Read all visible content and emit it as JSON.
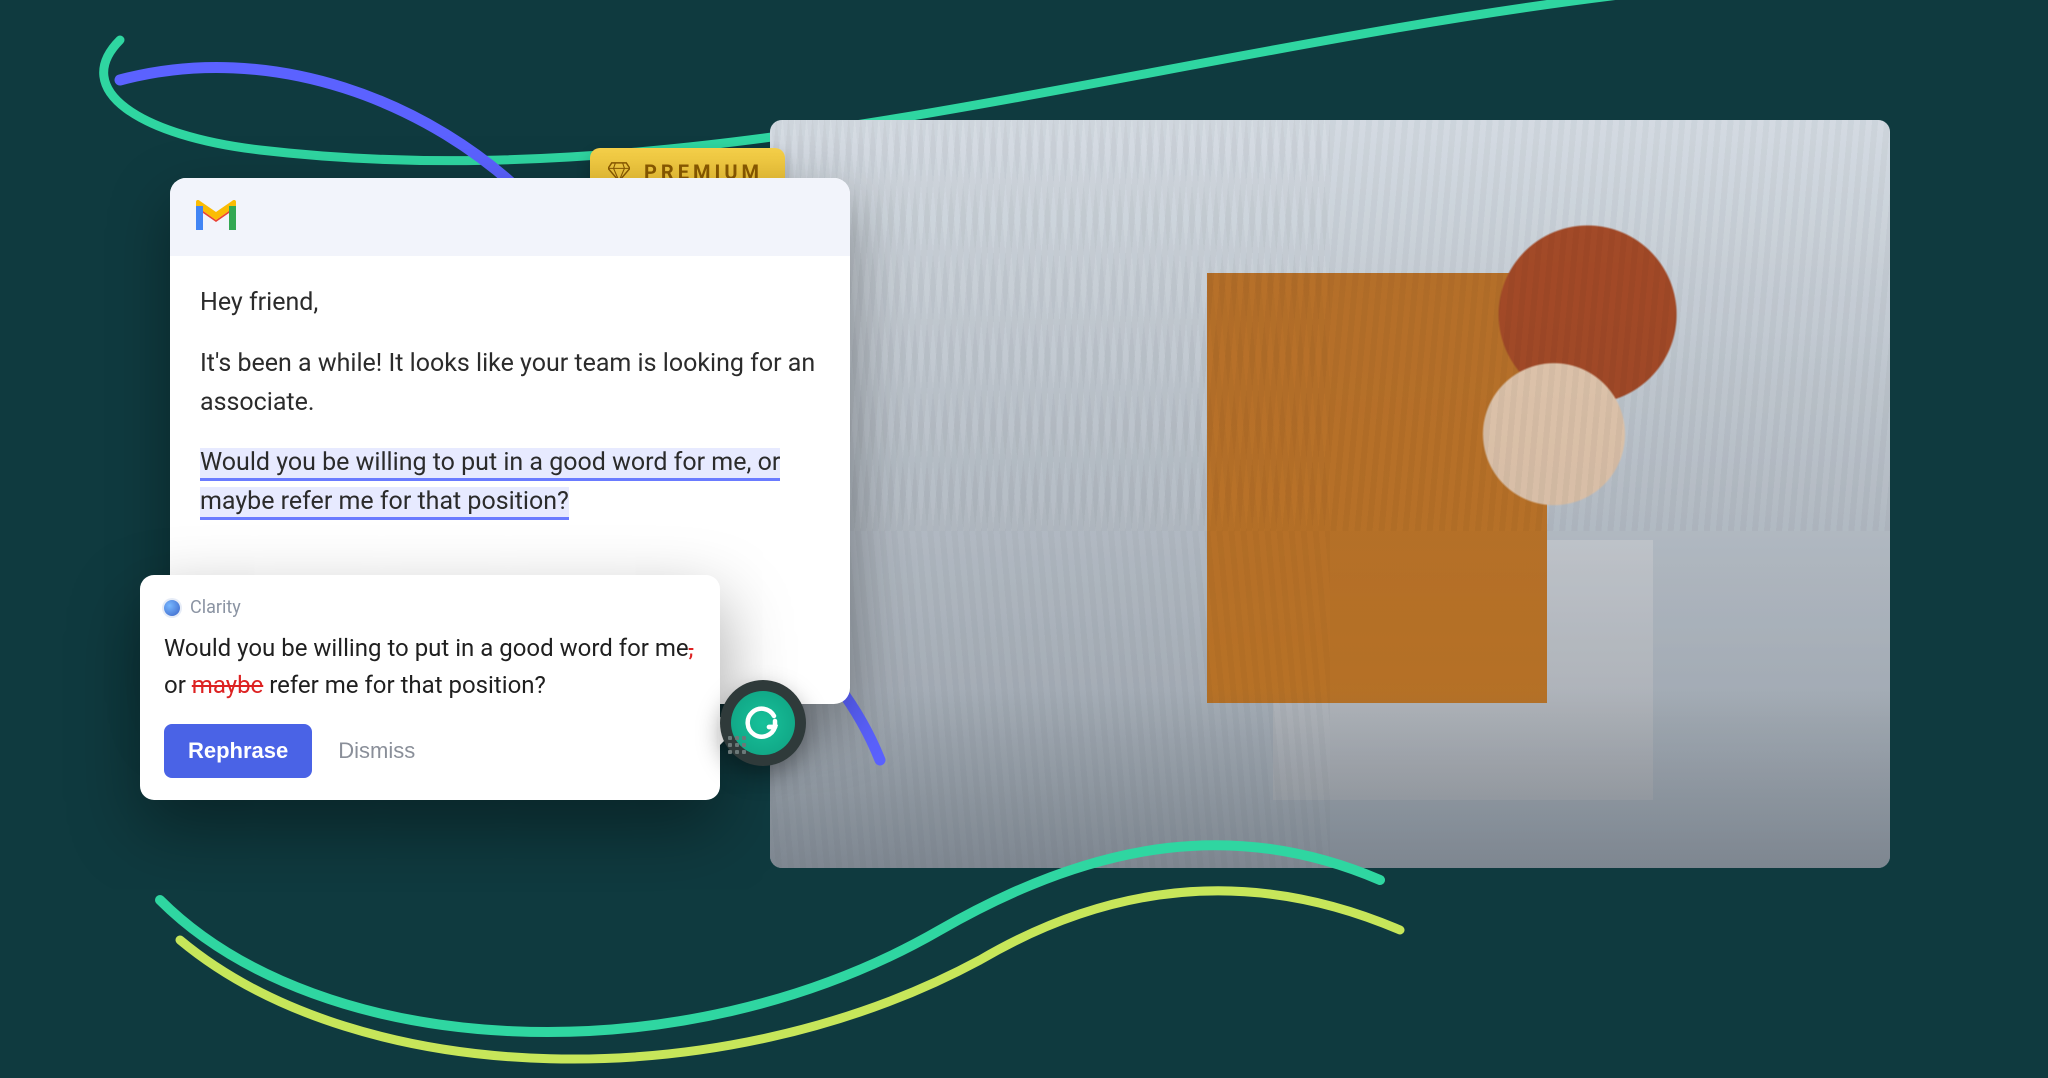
{
  "premium": {
    "label": "PREMIUM"
  },
  "email": {
    "greeting": "Hey friend,",
    "line1": "It's been a while! It looks like your team is looking for an associate.",
    "highlighted": "Would you be willing to put in a good word for me, or maybe refer me for that position?"
  },
  "suggestion": {
    "category": "Clarity",
    "text_before": "Would you be willing to put in a good word for me",
    "strike_comma": ",",
    "text_mid": " or ",
    "strike_word": "maybe",
    "text_after": " refer me for that position?",
    "primary_action": "Rephrase",
    "dismiss_action": "Dismiss"
  },
  "colors": {
    "bg": "#0f3a3f",
    "accent_blue": "#5b62ff",
    "accent_green": "#17c19a",
    "premium_gold": "#e9bb2e"
  }
}
